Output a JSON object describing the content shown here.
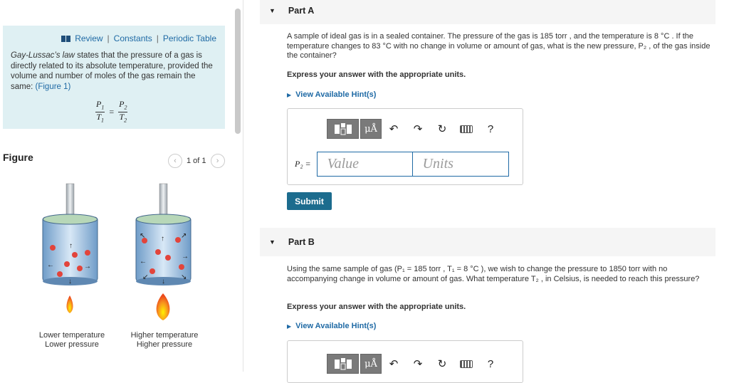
{
  "left": {
    "links": {
      "review": "Review",
      "constants": "Constants",
      "periodic": "Periodic Table",
      "sep": "|"
    },
    "law": {
      "italic": "Gay-Lussac’s law",
      "text": " states that the pressure of a gas is directly related to its absolute temperature, provided the volume and number of moles of the gas remain the same: ",
      "figure_link": "(Figure 1)"
    },
    "formula": {
      "p1": "P",
      "t1": "T",
      "p2": "P",
      "t2": "T",
      "s1": "1",
      "s2": "2",
      "eq": "="
    },
    "figure": {
      "title": "Figure",
      "pager": "1 of 1",
      "caption_left_1": "Lower temperature",
      "caption_left_2": "Lower pressure",
      "caption_right_1": "Higher temperature",
      "caption_right_2": "Higher pressure"
    }
  },
  "partA": {
    "label": "Part A",
    "question": "A sample of ideal gas is in a sealed container. The pressure of the gas is 185 torr , and the temperature is 8 °C . If the temperature changes to 83 °C with no change in volume or amount of gas, what is the new pressure, P₂ , of the gas inside the container?",
    "instruction": "Express your answer with the appropriate units.",
    "hint": "View Available Hint(s)",
    "var_label": "P₂ =",
    "value_placeholder": "Value",
    "units_placeholder": "Units",
    "submit": "Submit"
  },
  "partB": {
    "label": "Part B",
    "question": "Using the same sample of gas (P₁ = 185 torr , T₁ = 8 °C ), we wish to change the pressure to 1850 torr with no accompanying change in volume or amount of gas. What temperature T₂ , in Celsius, is needed to reach this pressure?",
    "instruction": "Express your answer with the appropriate units.",
    "hint": "View Available Hint(s)"
  },
  "toolbar": {
    "mu": "μÅ",
    "help": "?",
    "undo": "↶",
    "redo": "↷",
    "reset": "↻"
  },
  "colors": {
    "accent": "#1f6aa5",
    "submit": "#1c6c8e",
    "info_bg": "#dff0f3"
  }
}
